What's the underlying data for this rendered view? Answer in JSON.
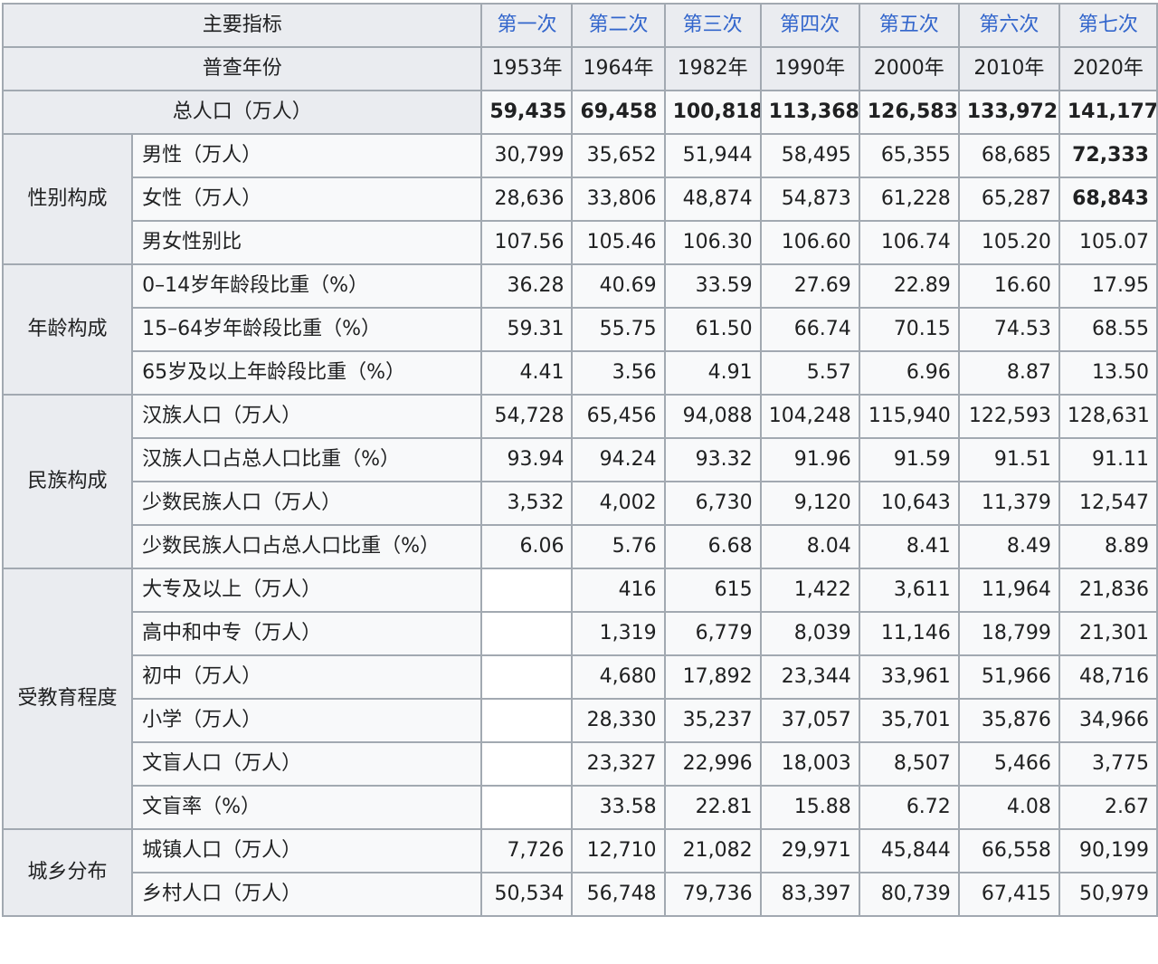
{
  "header": {
    "indicator_label": "主要指标",
    "year_label": "普查年份",
    "censuses": [
      "第一次",
      "第二次",
      "第三次",
      "第四次",
      "第五次",
      "第六次",
      "第七次"
    ],
    "years": [
      "1953年",
      "1964年",
      "1982年",
      "1990年",
      "2000年",
      "2010年",
      "2020年"
    ]
  },
  "total": {
    "label": "总人口（万人）",
    "values": [
      "59,435",
      "69,458",
      "100,818",
      "113,368",
      "126,583",
      "133,972",
      "141,177"
    ]
  },
  "groups": [
    {
      "label": "性别构成",
      "rows": [
        {
          "label": "男性（万人）",
          "values": [
            "30,799",
            "35,652",
            "51,944",
            "58,495",
            "65,355",
            "68,685",
            "72,333"
          ]
        },
        {
          "label": "女性（万人）",
          "values": [
            "28,636",
            "33,806",
            "48,874",
            "54,873",
            "61,228",
            "65,287",
            "68,843"
          ]
        },
        {
          "label": "男女性别比",
          "values": [
            "107.56",
            "105.46",
            "106.30",
            "106.60",
            "106.74",
            "105.20",
            "105.07"
          ]
        }
      ]
    },
    {
      "label": "年龄构成",
      "rows": [
        {
          "label": "0–14岁年龄段比重（%）",
          "values": [
            "36.28",
            "40.69",
            "33.59",
            "27.69",
            "22.89",
            "16.60",
            "17.95"
          ]
        },
        {
          "label": "15–64岁年龄段比重（%）",
          "values": [
            "59.31",
            "55.75",
            "61.50",
            "66.74",
            "70.15",
            "74.53",
            "68.55"
          ]
        },
        {
          "label": "65岁及以上年龄段比重（%）",
          "values": [
            "4.41",
            "3.56",
            "4.91",
            "5.57",
            "6.96",
            "8.87",
            "13.50"
          ]
        }
      ]
    },
    {
      "label": "民族构成",
      "rows": [
        {
          "label": "汉族人口（万人）",
          "values": [
            "54,728",
            "65,456",
            "94,088",
            "104,248",
            "115,940",
            "122,593",
            "128,631"
          ]
        },
        {
          "label": "汉族人口占总人口比重（%）",
          "values": [
            "93.94",
            "94.24",
            "93.32",
            "91.96",
            "91.59",
            "91.51",
            "91.11"
          ]
        },
        {
          "label": "少数民族人口（万人）",
          "values": [
            "3,532",
            "4,002",
            "6,730",
            "9,120",
            "10,643",
            "11,379",
            "12,547"
          ]
        },
        {
          "label": "少数民族人口占总人口比重（%）",
          "values": [
            "6.06",
            "5.76",
            "6.68",
            "8.04",
            "8.41",
            "8.49",
            "8.89"
          ]
        }
      ]
    },
    {
      "label": "受教育程度",
      "rows": [
        {
          "label": "大专及以上（万人）",
          "values": [
            "",
            "416",
            "615",
            "1,422",
            "3,611",
            "11,964",
            "21,836"
          ]
        },
        {
          "label": "高中和中专（万人）",
          "values": [
            "",
            "1,319",
            "6,779",
            "8,039",
            "11,146",
            "18,799",
            "21,301"
          ]
        },
        {
          "label": "初中（万人）",
          "values": [
            "",
            "4,680",
            "17,892",
            "23,344",
            "33,961",
            "51,966",
            "48,716"
          ]
        },
        {
          "label": "小学（万人）",
          "values": [
            "",
            "28,330",
            "35,237",
            "37,057",
            "35,701",
            "35,876",
            "34,966"
          ]
        },
        {
          "label": "文盲人口（万人）",
          "values": [
            "",
            "23,327",
            "22,996",
            "18,003",
            "8,507",
            "5,466",
            "3,775"
          ]
        },
        {
          "label": "文盲率（%）",
          "values": [
            "",
            "33.58",
            "22.81",
            "15.88",
            "6.72",
            "4.08",
            "2.67"
          ]
        }
      ]
    },
    {
      "label": "城乡分布",
      "rows": [
        {
          "label": "城镇人口（万人）",
          "values": [
            "7,726",
            "12,710",
            "21,082",
            "29,971",
            "45,844",
            "66,558",
            "90,199"
          ]
        },
        {
          "label": "乡村人口（万人）",
          "values": [
            "50,534",
            "56,748",
            "79,736",
            "83,397",
            "80,739",
            "67,415",
            "50,979"
          ]
        }
      ]
    }
  ]
}
